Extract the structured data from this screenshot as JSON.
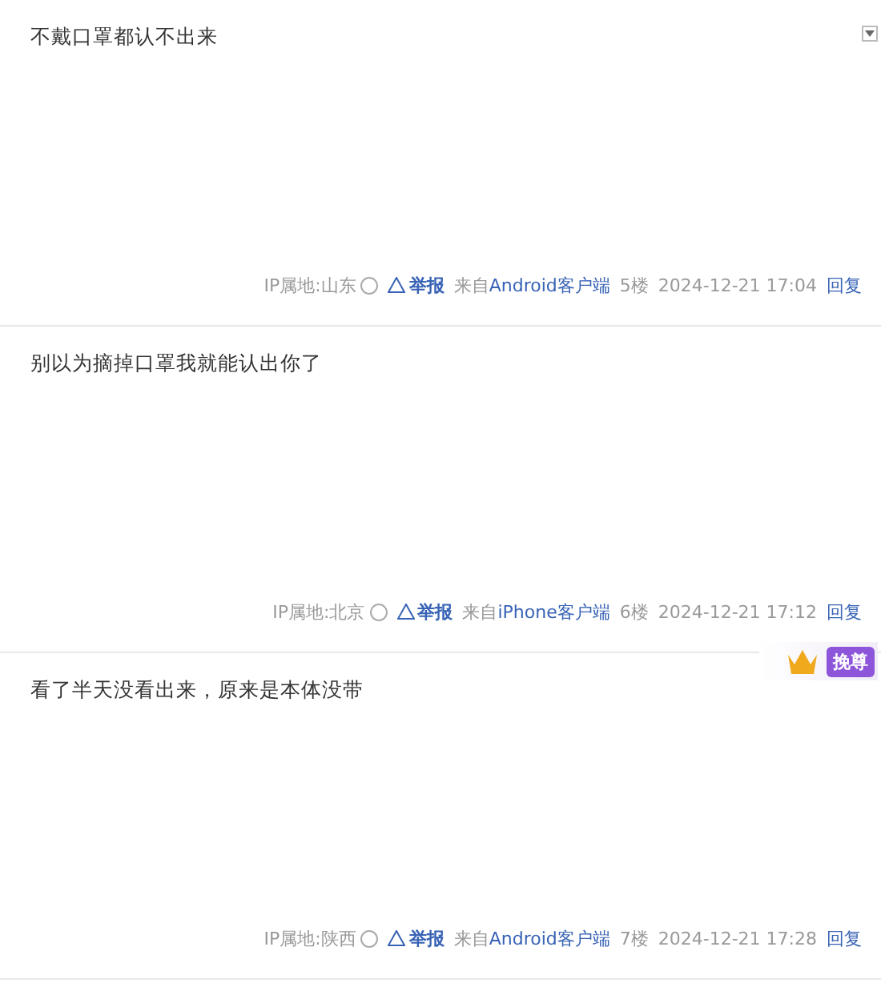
{
  "posts": [
    {
      "content": "不戴口罩都认不出来",
      "ip": "IP属地:山东",
      "report": "举报",
      "from_label": "来自",
      "client": "Android客户端",
      "floor": "5楼",
      "time": "2024-12-21 17:04",
      "reply": "回复",
      "menu": true
    },
    {
      "content": "别以为摘掉口罩我就能认出你了",
      "ip": "IP属地:北京",
      "report": "举报",
      "from_label": "来自",
      "client": "iPhone客户端",
      "floor": "6楼",
      "time": "2024-12-21 17:12",
      "reply": "回复",
      "menu": false
    },
    {
      "content": "看了半天没看出来，原来是本体没带",
      "ip": "IP属地:陕西",
      "report": "举报",
      "from_label": "来自",
      "client": "Android客户端",
      "floor": "7楼",
      "time": "2024-12-21 17:28",
      "reply": "回复",
      "menu": false,
      "badge": {
        "label": "挽尊"
      }
    }
  ]
}
